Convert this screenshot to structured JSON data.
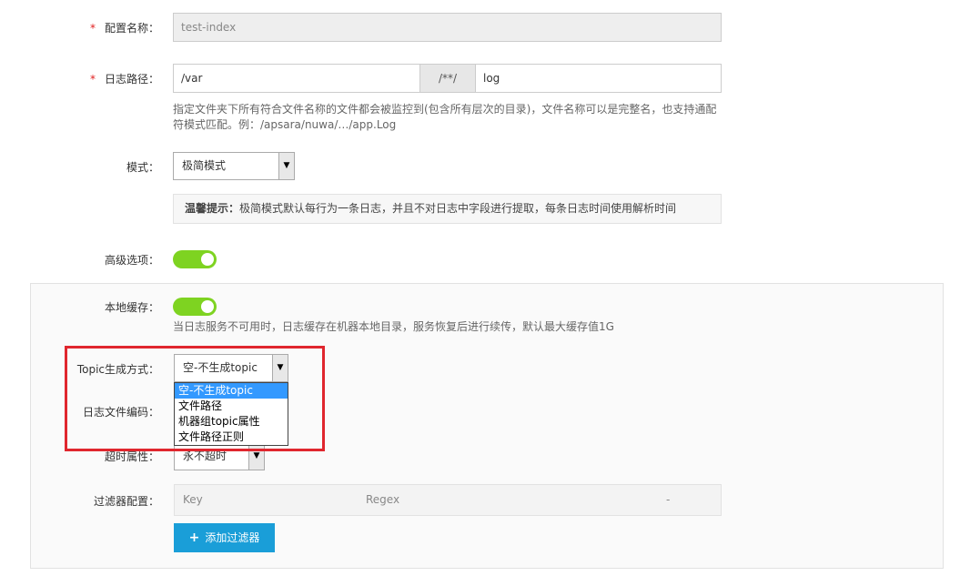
{
  "config_name": {
    "label": "配置名称：",
    "required_mark": "*",
    "value": "test-index"
  },
  "log_path": {
    "label": "日志路径：",
    "required_mark": "*",
    "dir_value": "/var",
    "pattern_addon": "/**/",
    "file_value": "log",
    "help_line1": "指定文件夹下所有符合文件名称的文件都会被监控到(包含所有层次的目录)，文件名称可以是完整名，也支持通配",
    "help_line2": "符模式匹配。例：/apsara/nuwa/…/app.Log"
  },
  "mode": {
    "label": "模式：",
    "selected": "极简模式",
    "tip_title": "温馨提示：",
    "tip_text": "极简模式默认每行为一条日志，并且不对日志中字段进行提取，每条日志时间使用解析时间"
  },
  "advanced": {
    "label": "高级选项：",
    "enabled": true
  },
  "local_cache": {
    "label": "本地缓存：",
    "enabled": true,
    "help": "当日志服务不可用时，日志缓存在机器本地目录，服务恢复后进行续传，默认最大缓存值1G"
  },
  "topic": {
    "label": "Topic生成方式：",
    "selected": "空-不生成topic",
    "options": [
      "空-不生成topic",
      "文件路径",
      "机器组topic属性",
      "文件路径正则"
    ]
  },
  "encoding": {
    "label": "日志文件编码："
  },
  "timeout": {
    "label": "超时属性：",
    "selected": "永不超时"
  },
  "filter": {
    "label": "过滤器配置：",
    "col_key": "Key",
    "col_regex": "Regex",
    "col_action": "-",
    "add_button": "添加过滤器",
    "add_icon": "+"
  },
  "colors": {
    "toggle_on": "#7ed321",
    "primary_button": "#1a9ed8",
    "highlight_box": "#e0262e",
    "dropdown_selected": "#3399ff"
  }
}
